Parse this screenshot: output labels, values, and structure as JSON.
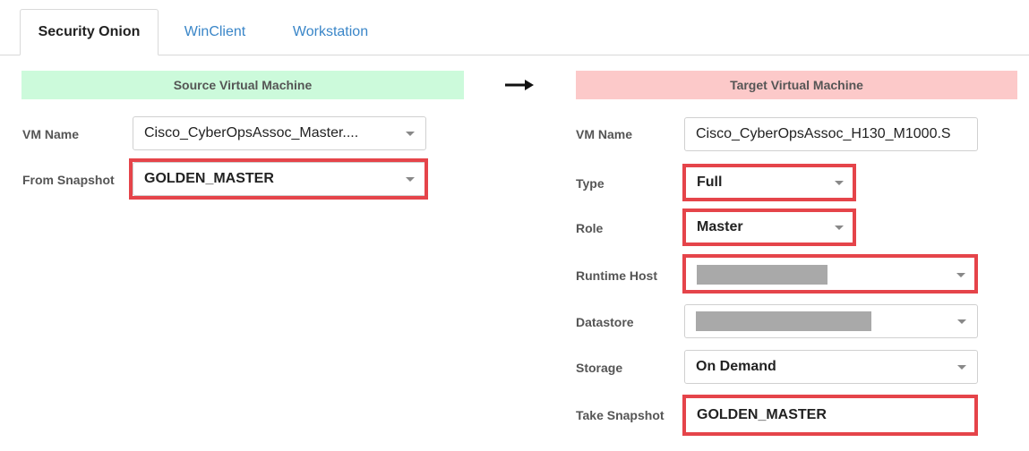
{
  "tabs": [
    "Security Onion",
    "WinClient",
    "Workstation"
  ],
  "source": {
    "header": "Source Virtual Machine",
    "vm_name_label": "VM Name",
    "vm_name_value": "Cisco_CyberOpsAssoc_Master....",
    "snapshot_label": "From Snapshot",
    "snapshot_value": "GOLDEN_MASTER"
  },
  "target": {
    "header": "Target Virtual Machine",
    "vm_name_label": "VM Name",
    "vm_name_value": "Cisco_CyberOpsAssoc_H130_M1000.S",
    "type_label": "Type",
    "type_value": "Full",
    "role_label": "Role",
    "role_value": "Master",
    "runtime_host_label": "Runtime Host",
    "datastore_label": "Datastore",
    "storage_label": "Storage",
    "storage_value": "On Demand",
    "take_snapshot_label": "Take Snapshot",
    "take_snapshot_value": "GOLDEN_MASTER"
  },
  "colors": {
    "source_header_bg": "#ccfadb",
    "target_header_bg": "#fcc9c9",
    "highlight": "#e5444a",
    "tab_link": "#3a86c8"
  },
  "icons": [
    "arrow-right-icon",
    "chevron-down-icon"
  ]
}
